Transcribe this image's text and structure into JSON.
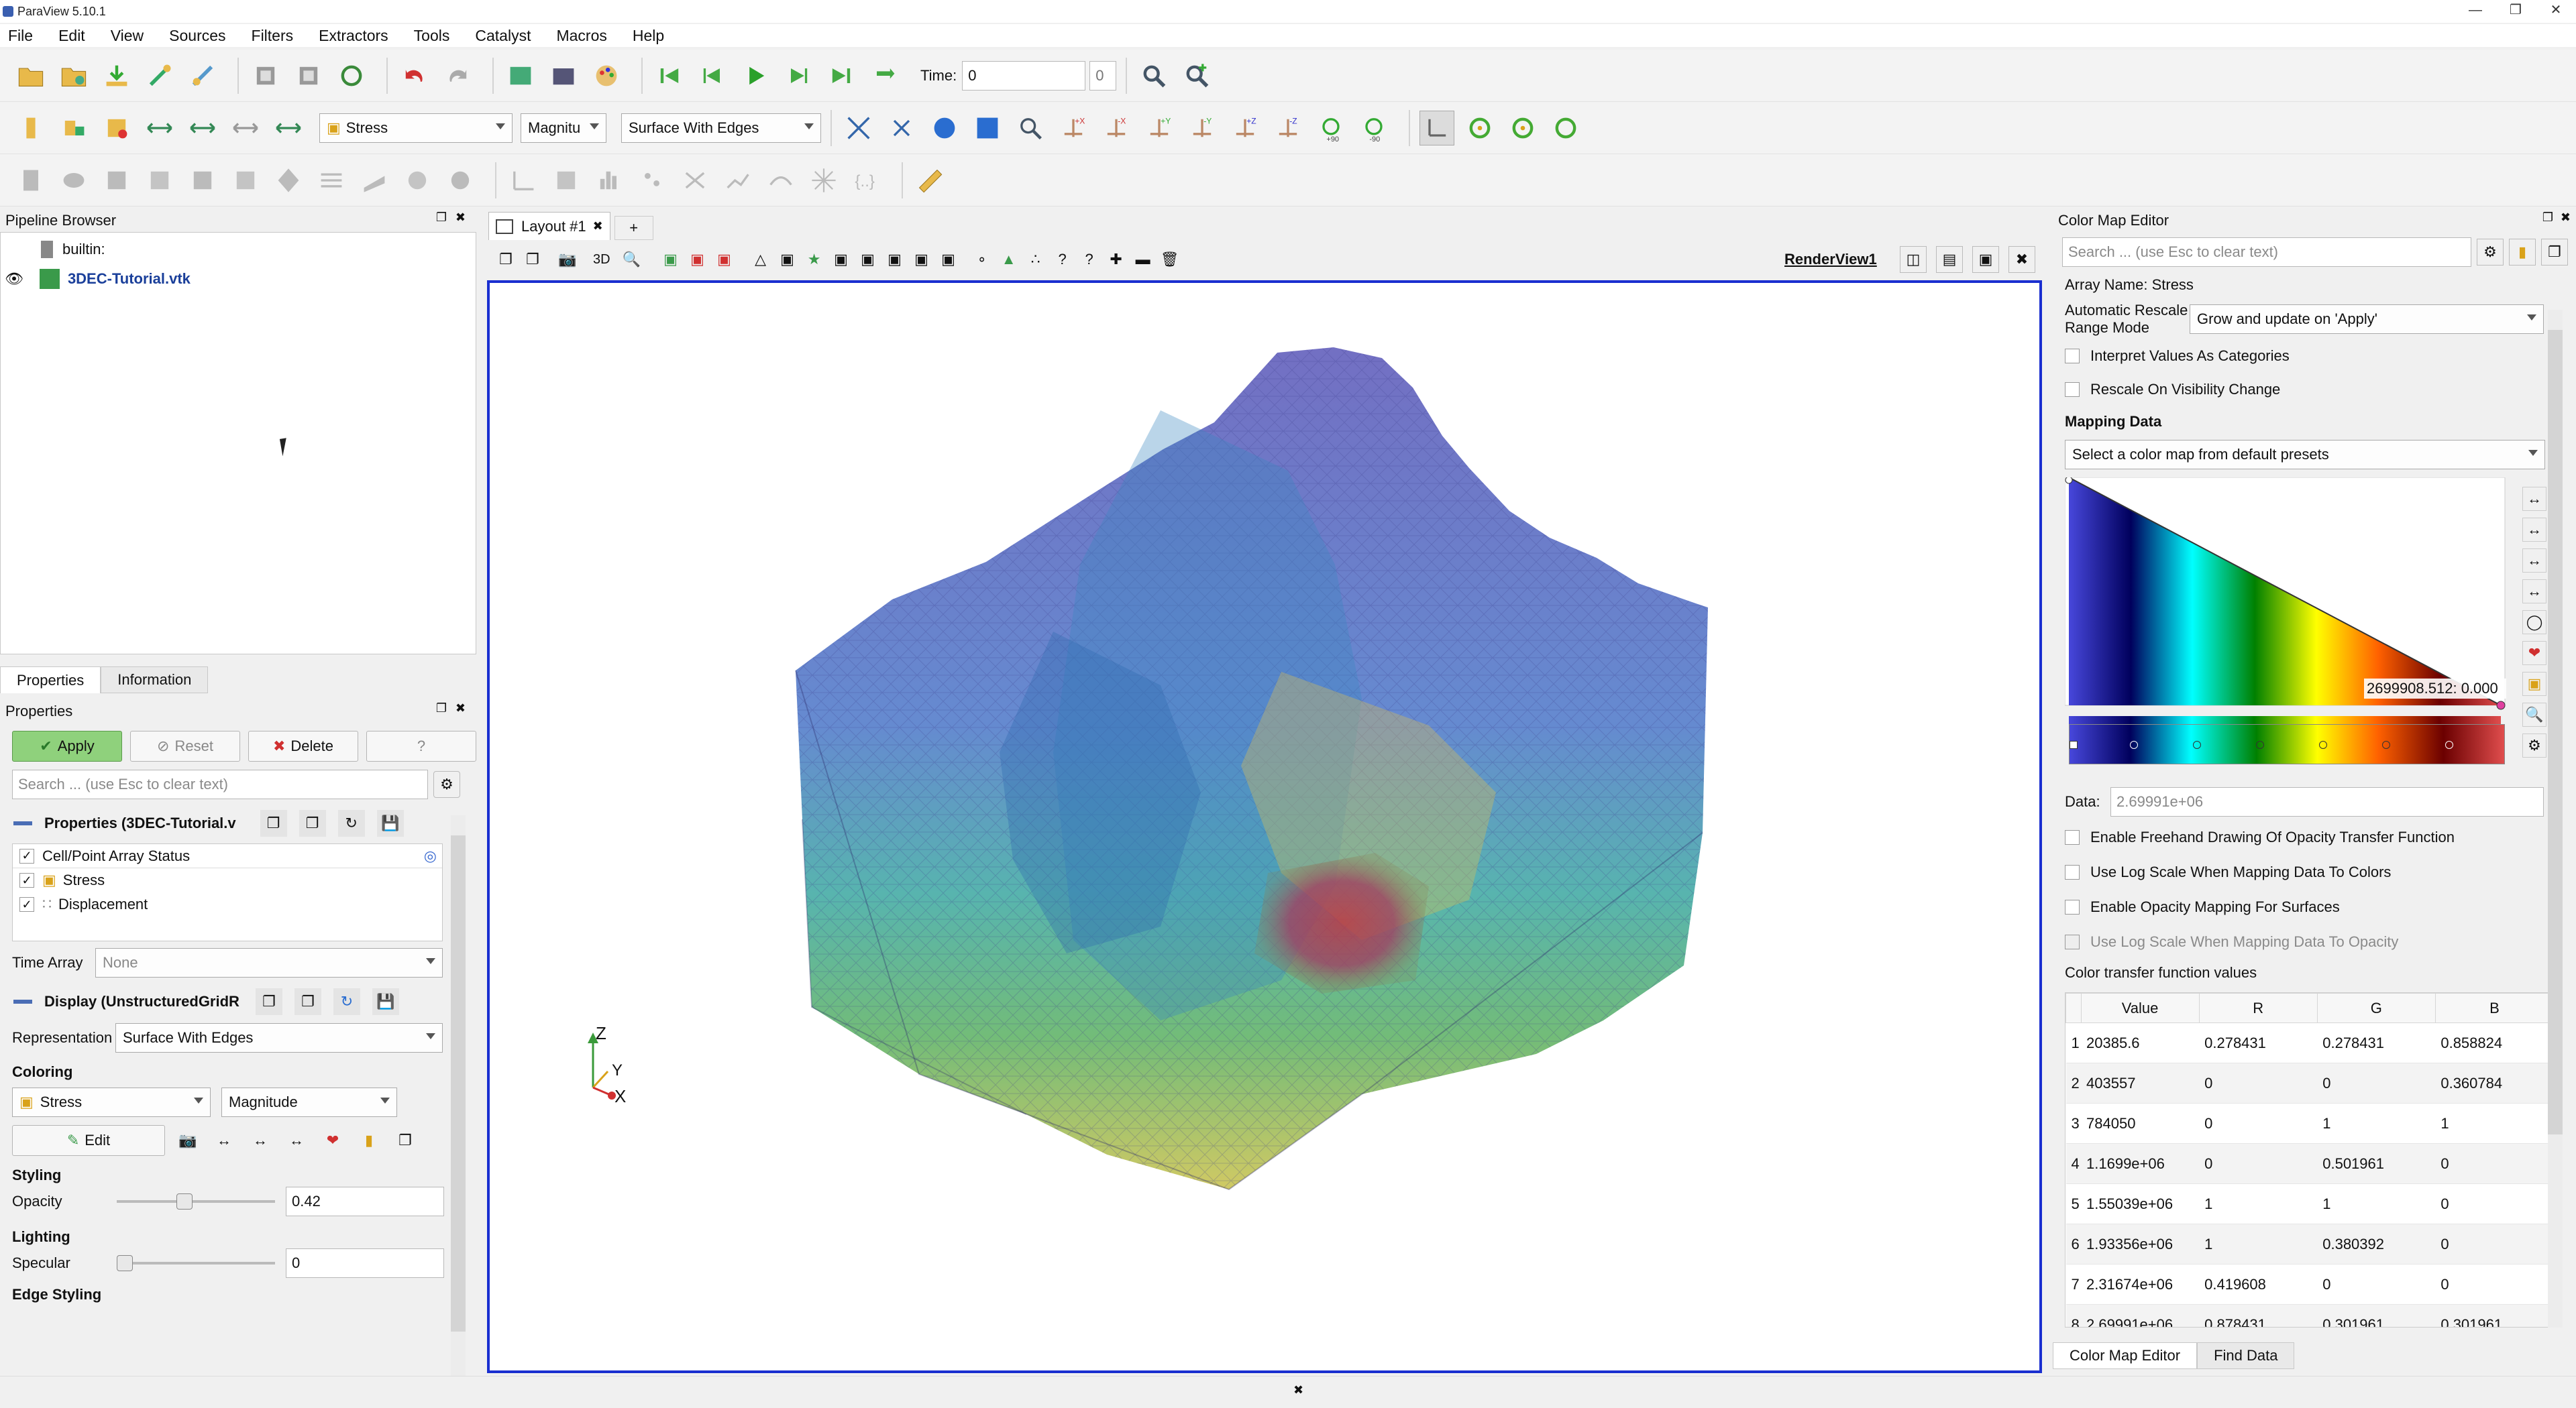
{
  "window": {
    "title": "ParaView 5.10.1"
  },
  "menu": [
    "File",
    "Edit",
    "View",
    "Sources",
    "Filters",
    "Extractors",
    "Tools",
    "Catalyst",
    "Macros",
    "Help"
  ],
  "toolbar1": {
    "time_label": "Time:",
    "time_value": "0",
    "time_step": "0"
  },
  "toolbar2": {
    "array_select": "Stress",
    "component_select": "Magnitu",
    "representation_select": "Surface With Edges",
    "rot_plus90": "+90",
    "rot_minus90": "-90"
  },
  "pipeline": {
    "header": "Pipeline Browser",
    "root": "builtin:",
    "item": "3DEC-Tutorial.vtk"
  },
  "tabs": {
    "properties": "Properties",
    "information": "Information"
  },
  "properties": {
    "header": "Properties",
    "apply": "Apply",
    "reset": "Reset",
    "delete": "Delete",
    "help": "?",
    "search_placeholder": "Search ... (use Esc to clear text)",
    "section_props": "Properties (3DEC-Tutorial.v",
    "array_status_header": "Cell/Point Array Status",
    "arrays": [
      "Stress",
      "Displacement"
    ],
    "time_array_label": "Time Array",
    "time_array_value": "None",
    "section_display": "Display (UnstructuredGridR",
    "representation_label": "Representation",
    "representation_value": "Surface With Edges",
    "coloring_label": "Coloring",
    "color_array": "Stress",
    "color_component": "Magnitude",
    "edit": "Edit",
    "styling_label": "Styling",
    "opacity_label": "Opacity",
    "opacity_value": "0.42",
    "opacity_fraction": 0.42,
    "lighting_label": "Lighting",
    "specular_label": "Specular",
    "specular_value": "0",
    "specular_fraction": 0,
    "edge_styling_label": "Edge Styling"
  },
  "layout": {
    "tab": "Layout #1",
    "add": "+",
    "view_name": "RenderView1",
    "mode3d": "3D"
  },
  "axes": {
    "z": "Z",
    "y": "Y",
    "x": "X"
  },
  "cme": {
    "header": "Color Map Editor",
    "search_placeholder": "Search ... (use Esc to clear text)",
    "array_name": "Array Name: Stress",
    "rescale_label": "Automatic Rescale Range Mode",
    "rescale_value": "Grow and update on 'Apply'",
    "interpret_categories": "Interpret Values As Categories",
    "rescale_visibility": "Rescale On Visibility Change",
    "mapping_data": "Mapping Data",
    "preset_placeholder": "Select a color map from default presets",
    "opacity_readout": "2699908.512: 0.000",
    "data_label": "Data:",
    "data_value": "2.69991e+06",
    "freehand": "Enable Freehand Drawing Of Opacity Transfer Function",
    "log_colors": "Use Log Scale When Mapping Data To Colors",
    "opacity_surfaces": "Enable Opacity Mapping For Surfaces",
    "log_opacity": "Use Log Scale When Mapping Data To Opacity",
    "ctf_label": "Color transfer function values",
    "columns": [
      "Value",
      "R",
      "G",
      "B"
    ],
    "rows": [
      [
        "1",
        "20385.6",
        "0.278431",
        "0.278431",
        "0.858824"
      ],
      [
        "2",
        "403557",
        "0",
        "0",
        "0.360784"
      ],
      [
        "3",
        "784050",
        "0",
        "1",
        "1"
      ],
      [
        "4",
        "1.1699e+06",
        "0",
        "0.501961",
        "0"
      ],
      [
        "5",
        "1.55039e+06",
        "1",
        "1",
        "0"
      ],
      [
        "6",
        "1.93356e+06",
        "1",
        "0.380392",
        "0"
      ],
      [
        "7",
        "2.31674e+06",
        "0.419608",
        "0",
        "0"
      ],
      [
        "8",
        "2.69991e+06",
        "0.878431",
        "0.301961",
        "0.301961"
      ]
    ],
    "bottom_tabs": [
      "Color Map Editor",
      "Find Data"
    ]
  },
  "colors": {
    "accent": "#1a2fd0",
    "apply_green": "#8fd17c"
  }
}
